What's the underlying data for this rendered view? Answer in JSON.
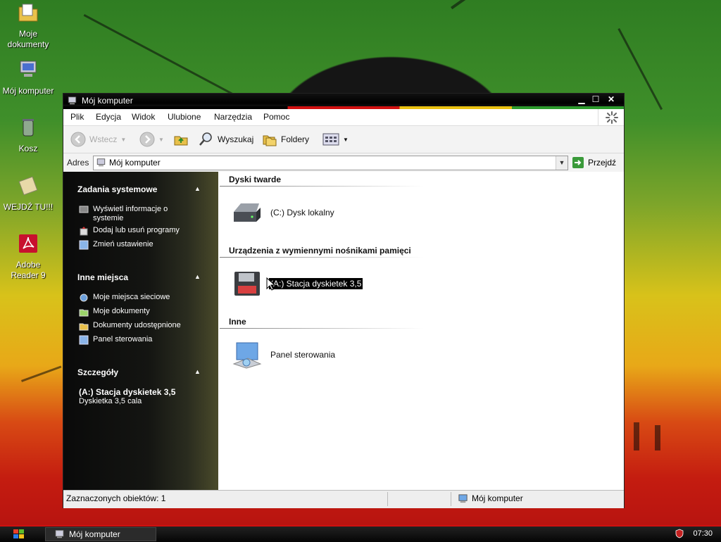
{
  "desktop": {
    "icons": [
      {
        "label": "Moje\ndokumenty",
        "icon": "my-documents-icon"
      },
      {
        "label": "Mój komputer",
        "icon": "my-computer-icon"
      },
      {
        "label": "Kosz",
        "icon": "recycle-bin-icon"
      },
      {
        "label": "WEJDŹ TU!!!",
        "icon": "shortcut-icon"
      },
      {
        "label": "Adobe\nReader 9",
        "icon": "adobe-reader-icon"
      }
    ]
  },
  "window": {
    "title": "Mój komputer",
    "menu": [
      "Plik",
      "Edycja",
      "Widok",
      "Ulubione",
      "Narzędzia",
      "Pomoc"
    ],
    "toolbar": {
      "back": "Wstecz",
      "search": "Wyszukaj",
      "folders": "Foldery"
    },
    "address": {
      "label": "Adres",
      "value": "Mój komputer",
      "go": "Przejdź"
    },
    "sidebar": {
      "sections": [
        {
          "title": "Zadania systemowe",
          "items": [
            "Wyświetl informacje o systemie",
            "Dodaj lub usuń programy",
            "Zmień ustawienie"
          ]
        },
        {
          "title": "Inne miejsca",
          "items": [
            "Moje miejsca sieciowe",
            "Moje dokumenty",
            "Dokumenty udostępnione",
            "Panel sterowania"
          ]
        },
        {
          "title": "Szczegóły",
          "detail_title": "(A:) Stacja dyskietek 3,5",
          "detail_sub": "Dyskietka 3,5 cala"
        }
      ]
    },
    "groups": [
      {
        "title": "Dyski twarde",
        "items": [
          {
            "label": "(C:) Dysk lokalny",
            "icon": "hard-drive-icon",
            "selected": false
          }
        ]
      },
      {
        "title": "Urządzenia z wymiennymi nośnikami pamięci",
        "items": [
          {
            "label": "(A:) Stacja dyskietek 3,5",
            "icon": "floppy-drive-icon",
            "selected": true
          }
        ]
      },
      {
        "title": "Inne",
        "items": [
          {
            "label": "Panel sterowania",
            "icon": "control-panel-icon",
            "selected": false
          }
        ]
      }
    ],
    "status": {
      "selected": "Zaznaczonych obiektów: 1",
      "location": "Mój komputer"
    }
  },
  "taskbar": {
    "task": "Mój komputer",
    "clock": "07:30"
  }
}
